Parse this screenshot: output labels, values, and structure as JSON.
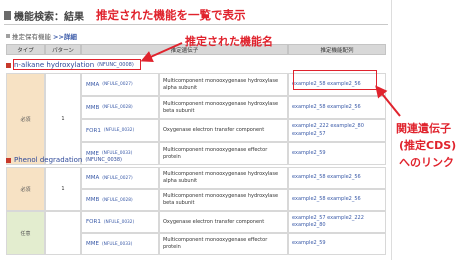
{
  "page": {
    "title": "機能検索：結果",
    "subtitle_prefix": "推定保有機能",
    "detail_link": ">>詳細"
  },
  "columns": {
    "type": "タイプ",
    "pattern": "パターン",
    "gene": "推定遺伝子",
    "cds": "推定機能配列"
  },
  "functions": [
    {
      "name": "n-alkane hydroxylation",
      "id": "(NFUNC_0008)",
      "type_label": "必須",
      "pattern": "1",
      "rows": [
        {
          "gene": "MMA",
          "gene_id": "(NFULE_0027)",
          "product": "Multicomponent monooxygenase hydroxylase alpha subunit",
          "cds": [
            "example2_58 example2_56"
          ]
        },
        {
          "gene": "MMB",
          "gene_id": "(NFULE_0028)",
          "product": "Multicomponent monooxygenase hydroxylase beta subunit",
          "cds": [
            "example2_58 example2_56"
          ]
        },
        {
          "gene": "FOR1",
          "gene_id": "(NFULE_0032)",
          "product": "Oxygenase electron transfer component",
          "cds": [
            "example2_222 example2_80",
            "example2_57"
          ]
        },
        {
          "gene": "MME",
          "gene_id": "(NFULE_0033)",
          "product": "Multicomponent monooxygenase effector protein",
          "cds": [
            "example2_59"
          ]
        }
      ]
    },
    {
      "name": "Phenol degradation",
      "id": "(NFUNC_0038)",
      "groups": [
        {
          "type_label": "必須",
          "pattern": "1"
        },
        {
          "type_label": "任意",
          "pattern": ""
        }
      ],
      "rows": [
        {
          "gene": "MMA",
          "gene_id": "(NFULE_0027)",
          "product": "Multicomponent monooxygenase hydroxylase alpha subunit",
          "cds": [
            "example2_58 example2_56"
          ]
        },
        {
          "gene": "MMB",
          "gene_id": "(NFULE_0028)",
          "product": "Multicomponent monooxygenase hydroxylase beta subunit",
          "cds": [
            "example2_58 example2_56"
          ]
        },
        {
          "gene": "FOR1",
          "gene_id": "(NFULE_0032)",
          "product": "Oxygenase electron transfer component",
          "cds": [
            "example2_57 example2_222",
            "example2_80"
          ]
        },
        {
          "gene": "MME",
          "gene_id": "(NFULE_0033)",
          "product": "Multicomponent monooxygenase effector protein",
          "cds": [
            "example2_59"
          ]
        }
      ]
    }
  ],
  "annotations": {
    "top": "推定された機能を一覧で表示",
    "func_name": "推定された機能名",
    "right_line1": "関連遺伝子",
    "right_line2": "(推定CDS)",
    "right_line3": "へのリンク"
  },
  "colors": {
    "accent_red": "#e0232d",
    "link_blue": "#3a5aa8",
    "required_bg": "#f7e2c4",
    "optional_bg": "#e3edcf"
  }
}
